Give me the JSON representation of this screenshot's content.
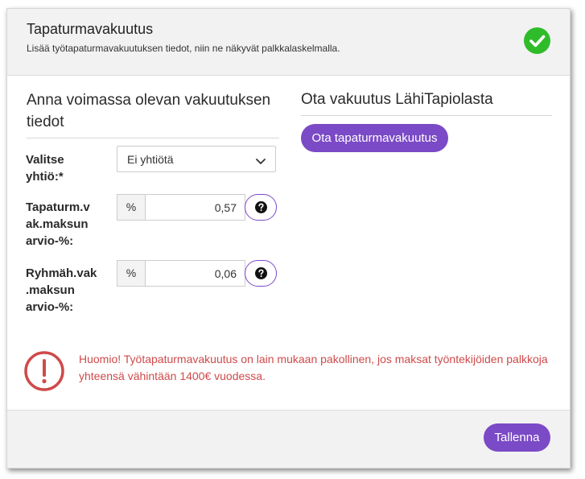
{
  "header": {
    "title": "Tapaturmavakuutus",
    "subtitle": "Lisää työtapaturmavakuutuksen tiedot, niin ne näkyvät palkkalaskelmalla.",
    "status_icon": "check-circle-icon",
    "status_color": "#2fbc2a"
  },
  "left": {
    "heading": "Anna voimassa olevan vakuutuksen tiedot",
    "company_label": "Valitse yhtiö:*",
    "company_value": "Ei yhtiötä",
    "accident_label": "Tapaturm.v ak.maksun arvio-%:",
    "accident_unit": "%",
    "accident_value": "0,57",
    "group_label": "Ryhmäh.vak .maksun arvio-%:",
    "group_unit": "%",
    "group_value": "0,06"
  },
  "right": {
    "heading": "Ota vakuutus LähiTapiolasta",
    "button_label": "Ota tapaturmavakuutus"
  },
  "warning": {
    "text": "Huomio! Työtapaturmavakuutus on lain mukaan pakollinen, jos maksat työntekijöiden palkkoja yhteensä vähintään 1400€ vuodessa.",
    "color": "#cf4a4a"
  },
  "footer": {
    "save_label": "Tallenna"
  },
  "colors": {
    "accent": "#7b4ac6"
  }
}
